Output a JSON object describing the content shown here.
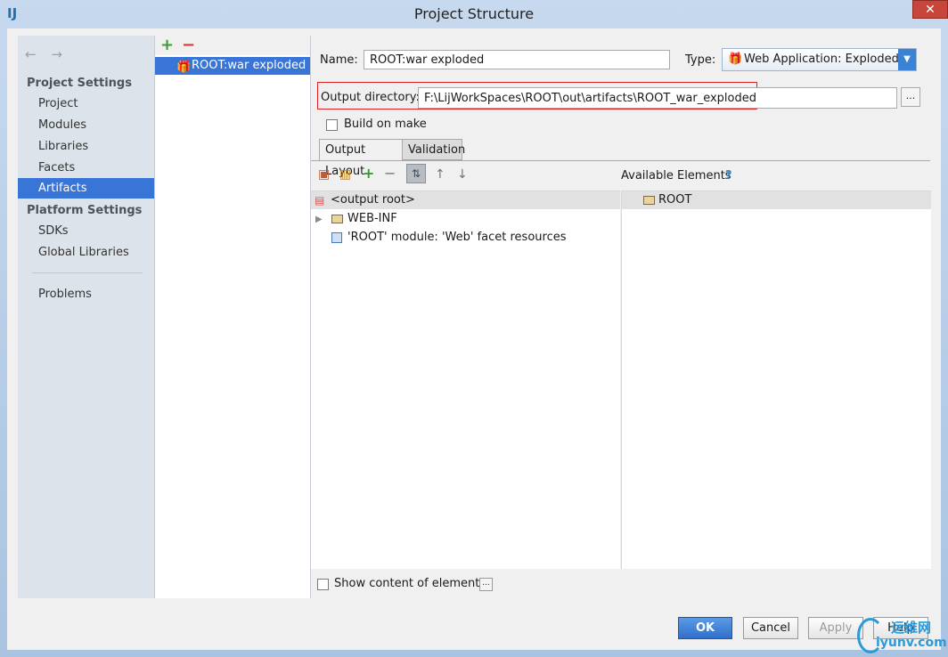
{
  "window": {
    "title": "Project Structure",
    "app_icon": "intellij-icon",
    "close_glyph": "✕"
  },
  "nav": {
    "arrows": [
      "←",
      "→"
    ],
    "section_project": "Project Settings",
    "items_project": [
      "Project",
      "Modules",
      "Libraries",
      "Facets",
      "Artifacts"
    ],
    "selected": "Artifacts",
    "section_platform": "Platform Settings",
    "items_platform": [
      "SDKs",
      "Global Libraries"
    ],
    "problems": "Problems"
  },
  "artifacts": {
    "add_glyph": "+",
    "remove_glyph": "−",
    "items": [
      "ROOT:war exploded"
    ]
  },
  "form": {
    "name_label": "Name:",
    "name_value": "ROOT:war exploded",
    "type_label": "Type:",
    "type_value": "Web Application: Exploded",
    "output_dir_label": "Output directory:",
    "output_dir_value": "F:\\LijWorkSpaces\\ROOT\\out\\artifacts\\ROOT_war_exploded",
    "browse_label": "...",
    "build_on_make_label": "Build on make",
    "build_on_make_checked": false
  },
  "tabs": [
    "Output Layout",
    "Validation"
  ],
  "active_tab": "Output Layout",
  "layout": {
    "available_elements_label": "Available Elements",
    "help_glyph": "?",
    "tree": [
      {
        "label": "<output root>"
      },
      {
        "label": "WEB-INF"
      },
      {
        "label": "'ROOT' module: 'Web' facet resources"
      }
    ],
    "available": [
      {
        "label": "ROOT"
      }
    ],
    "show_content_label": "Show content of elements",
    "show_content_btn": "..."
  },
  "buttons": {
    "ok": "OK",
    "cancel": "Cancel",
    "apply": "Apply",
    "help": "Help"
  },
  "watermark": {
    "cn": "运维网",
    "en": "iyunv.com"
  }
}
